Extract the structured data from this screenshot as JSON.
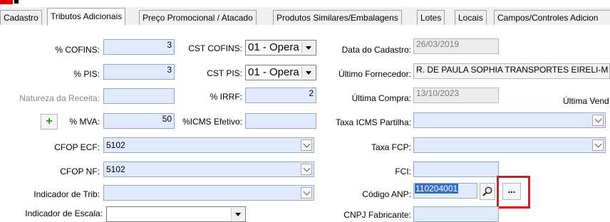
{
  "tabs": [
    {
      "label": "Cadastro"
    },
    {
      "label": "Tributos Adicionais"
    },
    {
      "label": "Preço Promocional / Atacado"
    },
    {
      "label": "Produtos Similares/Embalagens"
    },
    {
      "label": "Lotes"
    },
    {
      "label": "Locais"
    },
    {
      "label": "Campos/Controles Adicion"
    }
  ],
  "active_tab_index": 1,
  "left": {
    "cofins_label": "% COFINS:",
    "cofins_value": "3",
    "pis_label": "% PIS:",
    "pis_value": "3",
    "natureza_label": "Natureza da Receita:",
    "natureza_value": "",
    "mva_plus": "+",
    "mva_label": "% MVA:",
    "mva_value": "50",
    "cfop_ecf_label": "CFOP ECF:",
    "cfop_ecf_value": "5102",
    "cfop_nf_label": "CFOP NF:",
    "cfop_nf_value": "5102",
    "indicador_trib_label": "Indicador de Trib:",
    "indicador_trib_value": "",
    "indicador_escala_label": "Indicador de Escala:"
  },
  "middle": {
    "cst_cofins_label": "CST COFINS:",
    "cst_cofins_value": "01 - Opera",
    "cst_pis_label": "CST PIS:",
    "cst_pis_value": "01 - Opera",
    "irrf_label": "% IRRF:",
    "irrf_value": "2",
    "icms_efetivo_label": "%ICMS Efetivo:",
    "icms_efetivo_value": ""
  },
  "right": {
    "data_cadastro_label": "Data do Cadastro:",
    "data_cadastro_value": "26/03/2019",
    "ultimo_fornecedor_label": "Último Fornecedor:",
    "ultimo_fornecedor_value": "R. DE PAULA SOPHIA TRANSPORTES EIRELI-M",
    "ultima_compra_label": "Última Compra:",
    "ultima_compra_value": "13/10/2023",
    "ultima_venda_label": "Última Vend",
    "taxa_icms_partilha_label": "Taxa ICMS Partilha:",
    "taxa_icms_partilha_value": "",
    "taxa_fcp_label": "Taxa FCP:",
    "taxa_fcp_value": "",
    "fci_label": "FCI:",
    "fci_value": "",
    "codigo_anp_label": "Código ANP:",
    "codigo_anp_value": "110204001",
    "ellipsis_label": "...",
    "cnpj_fabricante_label": "CNPJ Fabricante:"
  },
  "colors": {
    "highlight_frame": "#e3141b",
    "input_bg": "#dfeafd",
    "selection": "#2f6fd3"
  }
}
